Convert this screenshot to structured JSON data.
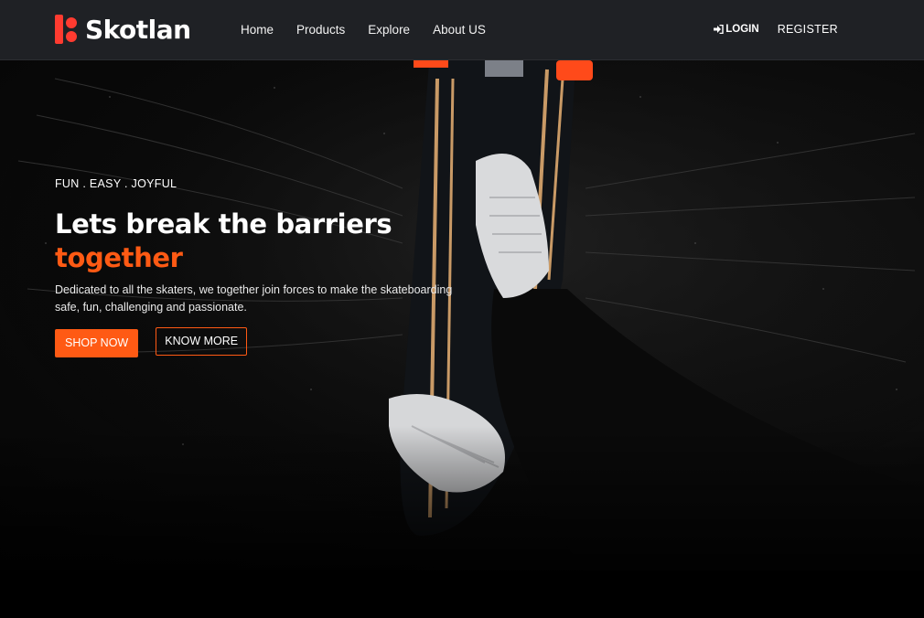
{
  "brand": {
    "name": "Skotlan",
    "logo_icon": "skotlan-logo-icon",
    "accent": "#ff3b30"
  },
  "nav": {
    "items": [
      {
        "label": "Home"
      },
      {
        "label": "Products"
      },
      {
        "label": "Explore"
      },
      {
        "label": "About US"
      }
    ],
    "login_label": "LOGIN",
    "login_icon": "sign-in-icon",
    "register_label": "REGISTER"
  },
  "hero": {
    "tagline": "FUN . EASY . JOYFUL",
    "headline": "Lets break the barriers",
    "headline_accent": "together",
    "description": "Dedicated to all the skaters, we together join forces to make the skateboarding safe, fun, challenging and passionate.",
    "primary_button": "SHOP NOW",
    "secondary_button": "KNOW MORE",
    "accent_color": "#ff5a14",
    "background_image": "skateboard-sneakers-photo"
  }
}
